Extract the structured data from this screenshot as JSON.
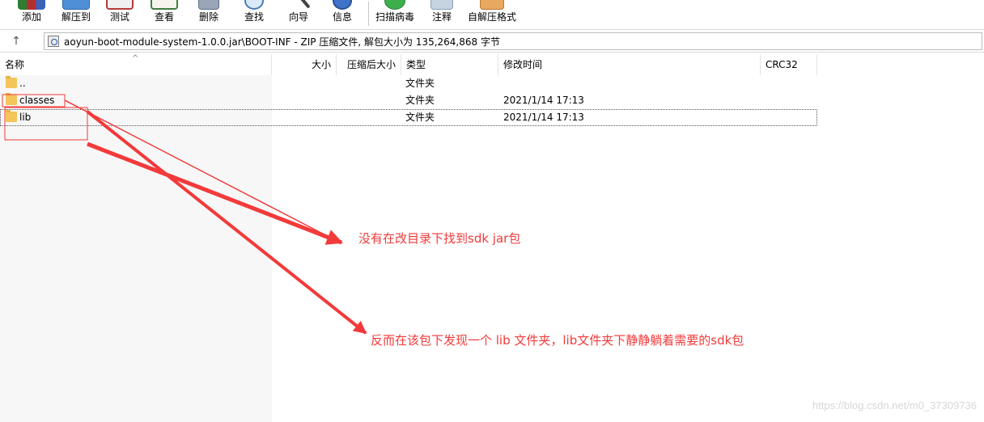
{
  "toolbar": {
    "buttons": [
      {
        "label": "添加",
        "icon": "add-archive-icon",
        "color": "#3b8f3b"
      },
      {
        "label": "解压到",
        "icon": "extract-to-icon",
        "color": "#3a78c8"
      },
      {
        "label": "测试",
        "icon": "test-icon",
        "color": "#b23a3a"
      },
      {
        "label": "查看",
        "icon": "view-book-icon",
        "color": "#3f7d3f"
      },
      {
        "label": "删除",
        "icon": "delete-icon",
        "color": "#7f8ea6"
      },
      {
        "label": "查找",
        "icon": "find-magnifier-icon",
        "color": "#4a7bb8"
      },
      {
        "label": "向导",
        "icon": "wizard-wand-icon",
        "color": "#555555"
      },
      {
        "label": "信息",
        "icon": "info-icon",
        "color": "#2f5fb5"
      },
      {
        "label": "扫描病毒",
        "icon": "virus-scan-icon",
        "color": "#2e9a3e"
      },
      {
        "label": "注释",
        "icon": "comment-icon",
        "color": "#8aa0b8"
      },
      {
        "label": "自解压格式",
        "icon": "sfx-box-icon",
        "color": "#d9924a"
      }
    ]
  },
  "address": {
    "path": "aoyun-boot-module-system-1.0.0.jar\\BOOT-INF - ZIP 压缩文件, 解包大小为 135,264,868 字节",
    "up_glyph": "↑"
  },
  "columns": {
    "name": "名称",
    "size": "大小",
    "packed": "压缩后大小",
    "type": "类型",
    "modified": "修改时间",
    "crc": "CRC32"
  },
  "files": [
    {
      "name": "..",
      "type": "文件夹",
      "modified": ""
    },
    {
      "name": "classes",
      "type": "文件夹",
      "modified": "2021/1/14 17:13"
    },
    {
      "name": "lib",
      "type": "文件夹",
      "modified": "2021/1/14 17:13"
    }
  ],
  "annotations": {
    "note1": "没有在改目录下找到sdk jar包",
    "note2": "反而在该包下发现一个 lib 文件夹，lib文件夹下静静躺着需要的sdk包",
    "color": "#f23a3a"
  },
  "watermark": "https://blog.csdn.net/m0_37309736"
}
